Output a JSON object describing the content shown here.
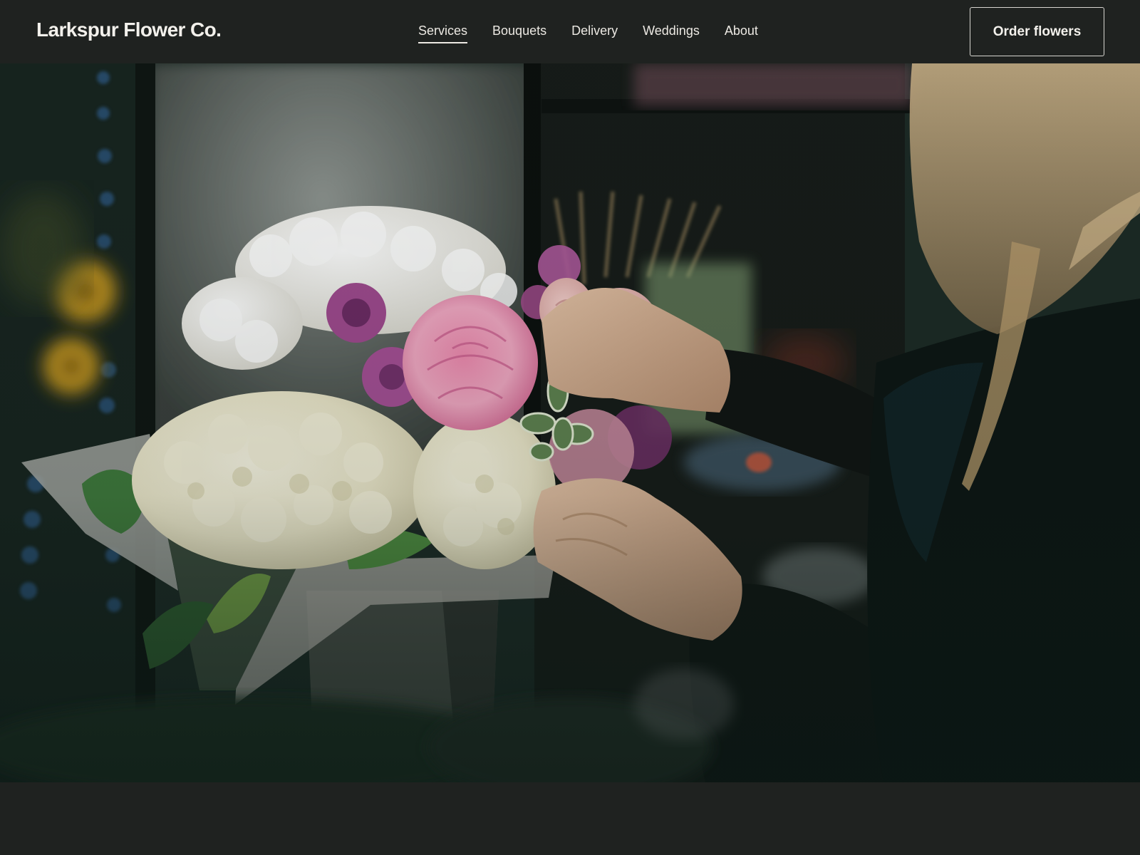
{
  "header": {
    "brand": "Larkspur Flower Co.",
    "nav": [
      {
        "label": "Services",
        "active": true
      },
      {
        "label": "Bouquets",
        "active": false
      },
      {
        "label": "Delivery",
        "active": false
      },
      {
        "label": "Weddings",
        "active": false
      },
      {
        "label": "About",
        "active": false
      }
    ],
    "cta_label": "Order flowers"
  },
  "hero": {
    "image": "florist-arranging-bouquet-photo"
  },
  "colors": {
    "header_bg": "#1f2220",
    "text": "#f3f1ec",
    "button_border": "#d7d5d0",
    "page_bg": "#1f2320"
  }
}
